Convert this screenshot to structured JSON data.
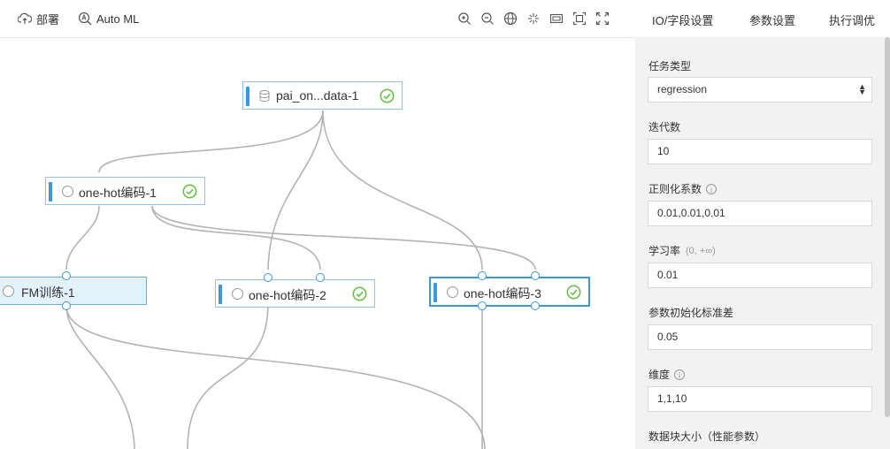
{
  "toolbar": {
    "deploy_label": "部署",
    "automl_label": "Auto ML",
    "icons": [
      "zoom-in-icon",
      "zoom-out-icon",
      "globe-icon",
      "full-view-icon",
      "minimap-icon",
      "fit-canvas-icon",
      "fullscreen-icon"
    ]
  },
  "nodes": {
    "data": {
      "label": "pai_on...data-1",
      "status": "success"
    },
    "onehot1": {
      "label": "one-hot编码-1",
      "status": "success"
    },
    "fm": {
      "label": "FM训练-1"
    },
    "onehot2": {
      "label": "one-hot编码-2",
      "status": "success"
    },
    "onehot3": {
      "label": "one-hot编码-3",
      "status": "success"
    }
  },
  "tabs": [
    {
      "label": "IO/字段设置"
    },
    {
      "label": "参数设置"
    },
    {
      "label": "执行调优"
    }
  ],
  "form": {
    "task_type": {
      "label": "任务类型",
      "value": "regression"
    },
    "iterations": {
      "label": "迭代数",
      "value": "10"
    },
    "regularization": {
      "label": "正则化系数",
      "value": "0.01,0.01,0.01"
    },
    "learning_rate": {
      "label": "学习率",
      "hint": "(0, +∞)",
      "value": "0.01"
    },
    "init_std": {
      "label": "参数初始化标准差",
      "value": "0.05"
    },
    "dimension": {
      "label": "维度",
      "value": "1,1,10"
    },
    "block_size": {
      "label": "数据块大小（性能参数）"
    }
  },
  "colors": {
    "accent": "#3a96dd",
    "success": "#6cbf4a",
    "edge": "#b3b3b3"
  }
}
